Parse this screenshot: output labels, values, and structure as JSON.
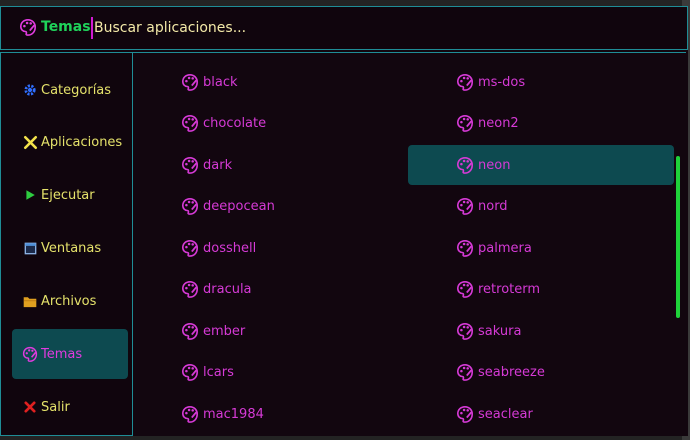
{
  "header": {
    "mode_label": "Temas",
    "search_placeholder": "Buscar aplicaciones..."
  },
  "sidebar": {
    "items": [
      {
        "label": "Categorías",
        "icon": "gear-icon",
        "color": "#2f6fff"
      },
      {
        "label": "Aplicaciones",
        "icon": "tools-icon",
        "color": "#f3e24b"
      },
      {
        "label": "Ejecutar",
        "icon": "play-icon",
        "color": "#2ecc40"
      },
      {
        "label": "Ventanas",
        "icon": "window-icon",
        "color": "#4f8fd6"
      },
      {
        "label": "Archivos",
        "icon": "folder-icon",
        "color": "#e0a020"
      },
      {
        "label": "Temas",
        "icon": "palette-icon",
        "color": "#e13bdf",
        "active": true
      },
      {
        "label": "Salir",
        "icon": "close-icon",
        "color": "#e02020"
      }
    ]
  },
  "themes": {
    "column_left": [
      "black",
      "chocolate",
      "dark",
      "deepocean",
      "dosshell",
      "dracula",
      "ember",
      "lcars",
      "mac1984"
    ],
    "column_right": [
      "ms-dos",
      "neon2",
      "neon",
      "nord",
      "palmera",
      "retroterm",
      "sakura",
      "seabreeze",
      "seaclear"
    ],
    "selected": "neon"
  },
  "colors": {
    "accent": "#1f8d96",
    "selected_bg": "#0d4a50",
    "item_text": "#d63ad6",
    "mode_label": "#1fd25a",
    "placeholder": "#f3e9a8",
    "scrollbar": "#1fd23a"
  }
}
